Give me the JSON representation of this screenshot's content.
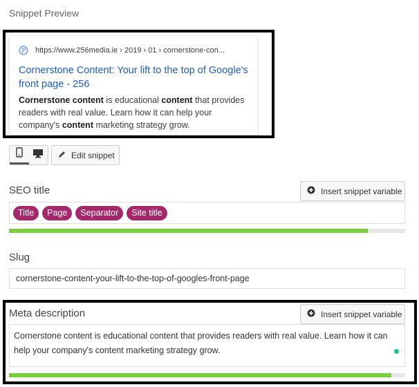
{
  "preview": {
    "heading": "Snippet Preview",
    "url": "https://www.256media.ie › 2019 › 01 › cornerstone-con...",
    "title": "Cornerstone Content: Your lift to the top of Google's front page - 256",
    "description": [
      {
        "text": "Cornerstone content",
        "bold": true
      },
      {
        "text": " is educational ",
        "bold": false
      },
      {
        "text": "content",
        "bold": true
      },
      {
        "text": " that provides readers with real value. Learn how it can help your company's ",
        "bold": false
      },
      {
        "text": "content",
        "bold": true
      },
      {
        "text": " marketing strategy grow.",
        "bold": false
      }
    ],
    "title_color": "#1e5ec8"
  },
  "toolbar": {
    "mode": "mobile",
    "edit_snippet_label": "Edit snippet"
  },
  "seo_title": {
    "label": "SEO title",
    "insert_label": "Insert snippet variable",
    "variables": [
      "Title",
      "Page",
      "Separator",
      "Site title"
    ],
    "progress": 0.905,
    "pill_color": "#a4286a"
  },
  "slug": {
    "label": "Slug",
    "value": "cornerstone-content-your-lift-to-the-top-of-googles-front-page"
  },
  "meta_description": {
    "label": "Meta description",
    "insert_label": "Insert snippet variable",
    "value": "Cornerstone content is educational content that provides readers with real value. Learn how it can help your company's content marketing strategy grow.",
    "progress": 0.965
  },
  "colors": {
    "progress_ok": "#7ad03a",
    "status_dot": "#1ec48a"
  }
}
